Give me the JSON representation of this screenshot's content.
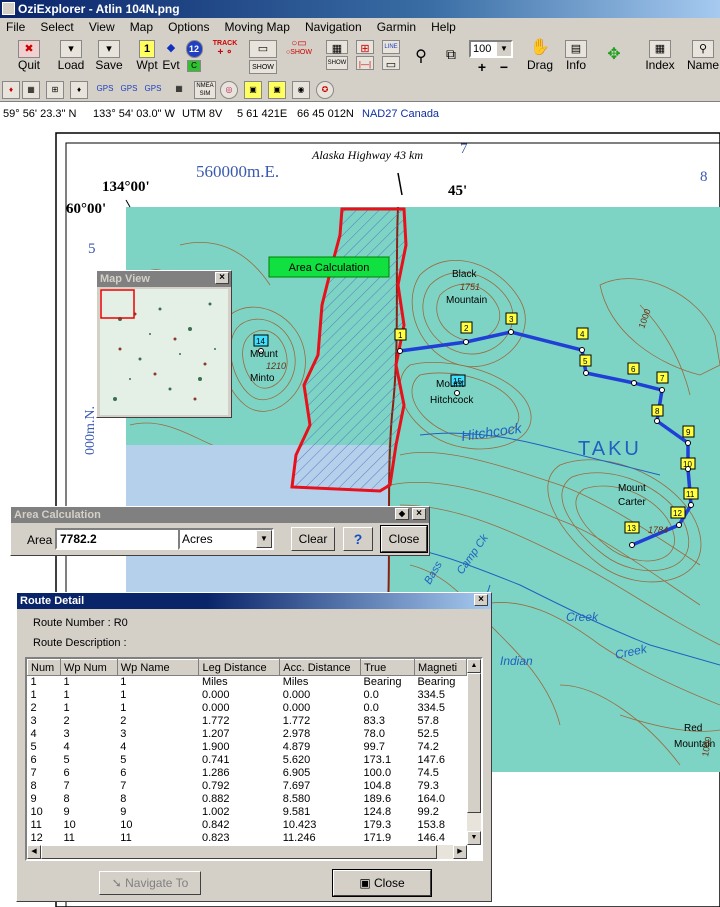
{
  "window": {
    "title": "OziExplorer - Atlin 104N.png"
  },
  "menu": [
    "File",
    "Select",
    "View",
    "Map",
    "Options",
    "Moving Map",
    "Navigation",
    "Garmin",
    "Help"
  ],
  "toolbar": {
    "quit": "Quit",
    "load": "Load",
    "save": "Save",
    "wpt": "Wpt",
    "evt": "Evt",
    "track": "TRACK",
    "show": "SHOW",
    "line": "LINE",
    "zoom": "100",
    "drag": "Drag",
    "info": "Info",
    "index": "Index",
    "name": "Name",
    "wpt_num": "1",
    "evt_num": "12",
    "nmea": "NMEA SIM",
    "gps": "GPS"
  },
  "coords": {
    "lat": "59° 56' 23.3\" N",
    "lon": "133° 54' 03.0\" W",
    "utm": "UTM  8V",
    "east": "5 61 421E",
    "north": "66 45 012N",
    "datum": "NAD27 Canada"
  },
  "map": {
    "top_label": "Alaska Highway 43 km",
    "easting": "560000m.E.",
    "grid7": "7",
    "grid8": "8",
    "lon1": "134°00'",
    "lon2": "45'",
    "lat1": "60°00'",
    "edge5": "5",
    "northing": "000m.N.",
    "black": "Black",
    "mountain": "Mountain",
    "elev1": "1751",
    "mount": "Mount",
    "minto": "Minto",
    "elev2": "1210",
    "mh1": "Mount",
    "mh2": "Hitchcock",
    "hitchcock": "Hitchcock",
    "taku": "TAKU",
    "carter1": "Mount",
    "carter2": "Carter",
    "elev3": "1784",
    "bass": "Bass",
    "camp": "Camp Ck",
    "creek": "Creek",
    "red": "Red",
    "redm": "Mountain",
    "c1000": "1000",
    "c1000b": "1000",
    "indian": "Indian",
    "area_label": "Area Calculation",
    "waypoints": [
      "1",
      "2",
      "3",
      "4",
      "5",
      "6",
      "7",
      "8",
      "9",
      "10",
      "11",
      "12",
      "13",
      "14",
      "15"
    ]
  },
  "mapview": {
    "title": "Map View"
  },
  "area_dialog": {
    "title": "Area Calculation",
    "area_label": "Area",
    "area_value": "7782.2",
    "units": "Acres",
    "clear": "Clear",
    "help": "?",
    "close": "Close"
  },
  "route_detail": {
    "title": "Route Detail",
    "route_number": "Route Number : R0",
    "route_description": "Route Description :",
    "columns": [
      "Num",
      "Wp Num",
      "Wp Name",
      "Leg Distance",
      "Acc. Distance",
      "True",
      "Magneti"
    ],
    "rows": [
      [
        "1",
        "1",
        "1",
        "Miles",
        "Miles",
        "Bearing",
        "Bearing"
      ],
      [
        "1",
        "1",
        "1",
        "0.000",
        "0.000",
        "0.0",
        "334.5"
      ],
      [
        "2",
        "1",
        "1",
        "0.000",
        "0.000",
        "0.0",
        "334.5"
      ],
      [
        "3",
        "2",
        "2",
        "1.772",
        "1.772",
        "83.3",
        "57.8"
      ],
      [
        "4",
        "3",
        "3",
        "1.207",
        "2.978",
        "78.0",
        "52.5"
      ],
      [
        "5",
        "4",
        "4",
        "1.900",
        "4.879",
        "99.7",
        "74.2"
      ],
      [
        "6",
        "5",
        "5",
        "0.741",
        "5.620",
        "173.1",
        "147.6"
      ],
      [
        "7",
        "6",
        "6",
        "1.286",
        "6.905",
        "100.0",
        "74.5"
      ],
      [
        "8",
        "7",
        "7",
        "0.792",
        "7.697",
        "104.8",
        "79.3"
      ],
      [
        "9",
        "8",
        "8",
        "0.882",
        "8.580",
        "189.6",
        "164.0"
      ],
      [
        "10",
        "9",
        "9",
        "1.002",
        "9.581",
        "124.8",
        "99.2"
      ],
      [
        "11",
        "10",
        "10",
        "0.842",
        "10.423",
        "179.3",
        "153.8"
      ],
      [
        "12",
        "11",
        "11",
        "0.823",
        "11.246",
        "171.9",
        "146.4"
      ]
    ],
    "navigate": "Navigate To",
    "close": "Close"
  },
  "colors": {
    "title_dark": "#0a246a",
    "route": "#1f3fd6",
    "area_outline": "#e8101a",
    "land": "#7ed4c4",
    "water": "#b5d0ea",
    "button": "#d4d0c8"
  }
}
